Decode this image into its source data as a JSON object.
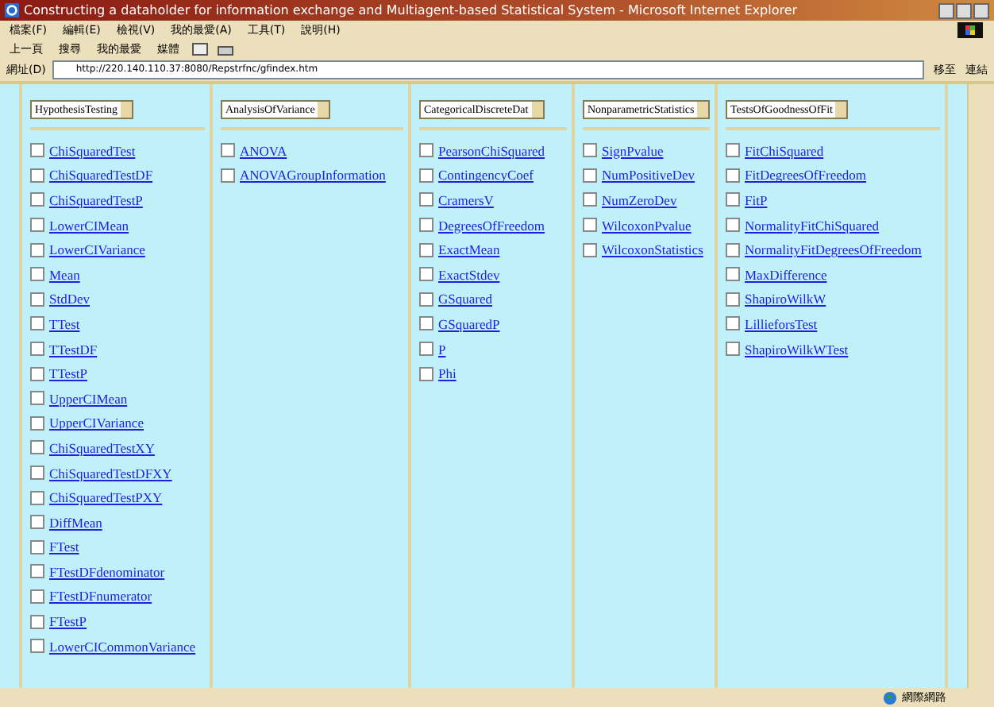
{
  "window": {
    "title": "Constructing a dataholder for information exchange and Multiagent-based Statistical System - Microsoft Internet Explorer"
  },
  "menu": [
    "檔案(F)",
    "編輯(E)",
    "檢視(V)",
    "我的最愛(A)",
    "工具(T)",
    "說明(H)"
  ],
  "toolbar": [
    {
      "label": "上一頁"
    },
    {
      "label": "搜尋"
    },
    {
      "label": "我的最愛"
    },
    {
      "label": "媒體"
    }
  ],
  "address": {
    "label": "網址(D)",
    "value": "http://220.140.110.37:8080/Repstrfnc/gfindex.htm",
    "go": "移至",
    "links": "連結"
  },
  "columns": [
    {
      "category": "HypothesisTesting",
      "items": [
        {
          "label": "ChiSquaredTest",
          "checked": false
        },
        {
          "label": "ChiSquaredTestDF",
          "checked": false
        },
        {
          "label": "ChiSquaredTestP",
          "checked": false
        },
        {
          "label": "LowerCIMean",
          "checked": false
        },
        {
          "label": "LowerCIVariance",
          "checked": false
        },
        {
          "label": "Mean",
          "checked": false
        },
        {
          "label": "StdDev",
          "checked": false
        },
        {
          "label": "TTest",
          "checked": false
        },
        {
          "label": "TTestDF",
          "checked": false
        },
        {
          "label": "TTestP",
          "checked": false
        },
        {
          "label": "UpperCIMean",
          "checked": false
        },
        {
          "label": "UpperCIVariance",
          "checked": false
        },
        {
          "label": "ChiSquaredTestXY",
          "checked": false
        },
        {
          "label": "ChiSquaredTestDFXY",
          "checked": false
        },
        {
          "label": "ChiSquaredTestPXY",
          "checked": false
        },
        {
          "label": "DiffMean",
          "checked": false
        },
        {
          "label": "FTest",
          "checked": false
        },
        {
          "label": "FTestDFdenominator",
          "checked": false
        },
        {
          "label": "FTestDFnumerator",
          "checked": false
        },
        {
          "label": "FTestP",
          "checked": false
        },
        {
          "label": "LowerCICommonVariance",
          "checked": false
        }
      ]
    },
    {
      "category": "AnalysisOfVariance",
      "items": [
        {
          "label": "ANOVA",
          "checked": false
        },
        {
          "label": "ANOVAGroupInformation",
          "checked": false
        }
      ]
    },
    {
      "category": "CategoricalDiscreteDat",
      "items": [
        {
          "label": "PearsonChiSquared",
          "checked": false
        },
        {
          "label": "ContingencyCoef",
          "checked": false
        },
        {
          "label": "CramersV",
          "checked": false
        },
        {
          "label": "DegreesOfFreedom",
          "checked": false
        },
        {
          "label": "ExactMean",
          "checked": false
        },
        {
          "label": "ExactStdev",
          "checked": false
        },
        {
          "label": "GSquared",
          "checked": false
        },
        {
          "label": "GSquaredP",
          "checked": false
        },
        {
          "label": "P",
          "checked": false
        },
        {
          "label": "Phi",
          "checked": false
        }
      ]
    },
    {
      "category": "NonparametricStatistics",
      "items": [
        {
          "label": "SignPvalue",
          "checked": false
        },
        {
          "label": "NumPositiveDev",
          "checked": false
        },
        {
          "label": "NumZeroDev",
          "checked": false
        },
        {
          "label": "WilcoxonPvalue",
          "checked": false
        },
        {
          "label": "WilcoxonStatistics",
          "checked": false
        }
      ]
    },
    {
      "category": "TestsOfGoodnessOfFit",
      "items": [
        {
          "label": "FitChiSquared",
          "checked": false
        },
        {
          "label": "FitDegreesOfFreedom",
          "checked": false
        },
        {
          "label": "FitP",
          "checked": false
        },
        {
          "label": "NormalityFitChiSquared",
          "checked": false
        },
        {
          "label": "NormalityFitDegreesOfFreedom",
          "checked": false
        },
        {
          "label": "MaxDifference",
          "checked": false
        },
        {
          "label": "ShapiroWilkW",
          "checked": false
        },
        {
          "label": "LillieforsTest",
          "checked": false
        },
        {
          "label": "ShapiroWilkWTest",
          "checked": false
        }
      ]
    }
  ],
  "status_bar": {
    "zone": "網際網路"
  }
}
